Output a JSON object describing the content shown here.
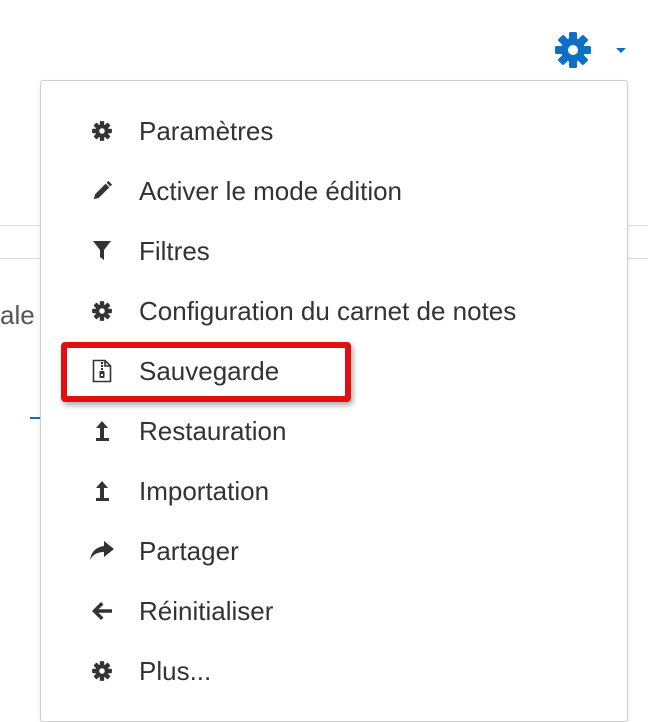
{
  "menu": {
    "items": [
      {
        "label": "Paramètres",
        "icon": "gear-icon"
      },
      {
        "label": "Activer le mode édition",
        "icon": "pencil-icon"
      },
      {
        "label": "Filtres",
        "icon": "filter-icon"
      },
      {
        "label": "Configuration du carnet de notes",
        "icon": "gear-icon"
      },
      {
        "label": "Sauvegarde",
        "icon": "backup-file-icon"
      },
      {
        "label": "Restauration",
        "icon": "upload-arrow-icon"
      },
      {
        "label": "Importation",
        "icon": "upload-arrow-icon"
      },
      {
        "label": "Partager",
        "icon": "share-arrow-icon"
      },
      {
        "label": "Réinitialiser",
        "icon": "back-arrow-icon"
      },
      {
        "label": "Plus...",
        "icon": "gear-icon"
      }
    ],
    "highlighted_item": "Sauvegarde"
  },
  "background": {
    "partial_text": "ale"
  },
  "colors": {
    "accent": "#0f6fc5",
    "highlight": "#e01010",
    "text": "#333333"
  }
}
